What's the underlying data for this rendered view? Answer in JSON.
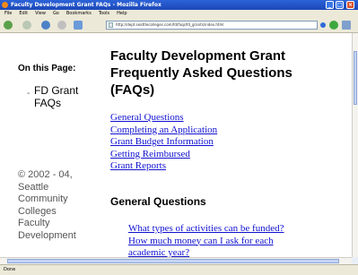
{
  "window": {
    "title": "Faculty Development Grant FAQs - Mozilla Firefox"
  },
  "menu": [
    "File",
    "Edit",
    "View",
    "Go",
    "Bookmarks",
    "Tools",
    "Help"
  ],
  "toolbar": {
    "url": "http://dept.seattlecolleges.com/fd/faqs/fd_grants/index.html"
  },
  "sidebar": {
    "heading": "On this Page:",
    "bullet": "-",
    "link_line1": "FD Grant",
    "link_line2": "FAQs",
    "footer_lines": [
      "© 2002 - 04,",
      "Seattle",
      "Community",
      "Colleges",
      "Faculty",
      "Development"
    ]
  },
  "main": {
    "title_lines": [
      "Faculty Development Grant",
      "Frequently Asked Questions",
      "(FAQs)"
    ],
    "toc": [
      "General Questions",
      "Completing an Application",
      "Grant Budget Information",
      "Getting Reimbursed",
      "Grant Reports"
    ],
    "section_heading": "General Questions",
    "questions": [
      "What types of activities can be funded?",
      "How much money can I ask for each",
      "academic year?"
    ]
  },
  "status": {
    "text": "Done"
  },
  "colors": {
    "link": "#1010d0",
    "titlebar": "#2b63d8"
  }
}
